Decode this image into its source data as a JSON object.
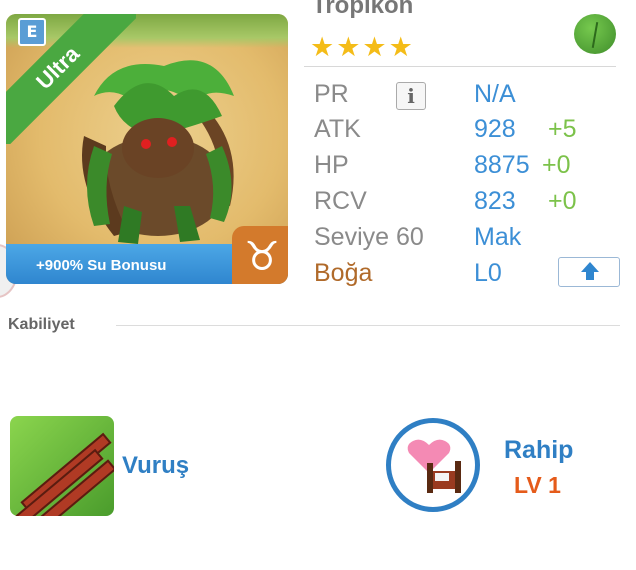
{
  "monster": {
    "name": "Tropikon",
    "rarity_label": "Ultra",
    "edition_badge": "E",
    "bonus_text": "+900% Su Bonusu",
    "zodiac_symbol": "♉",
    "stars": "★★★★",
    "element_icon": "leaf-element-icon"
  },
  "stats": {
    "pr": {
      "label": "PR",
      "value": "N/A",
      "info": "i"
    },
    "atk": {
      "label": "ATK",
      "value": "928",
      "bonus": "+5"
    },
    "hp": {
      "label": "HP",
      "value": "8875",
      "bonus": "+0"
    },
    "rcv": {
      "label": "RCV",
      "value": "823",
      "bonus": "+0"
    },
    "level": {
      "label": "Seviye 60",
      "value": "Mak"
    },
    "zodiac": {
      "label": "Boğa",
      "value": "L0"
    }
  },
  "ability": {
    "section_title": "Kabiliyet",
    "skill_name": "Vuruş",
    "leader_name": "Rahip",
    "leader_level": "LV 1"
  },
  "colors": {
    "accent_blue": "#2f7fc4",
    "bonus_green": "#7cc24a",
    "zodiac_orange": "#d37a2c",
    "leader_level": "#e55b1a"
  }
}
